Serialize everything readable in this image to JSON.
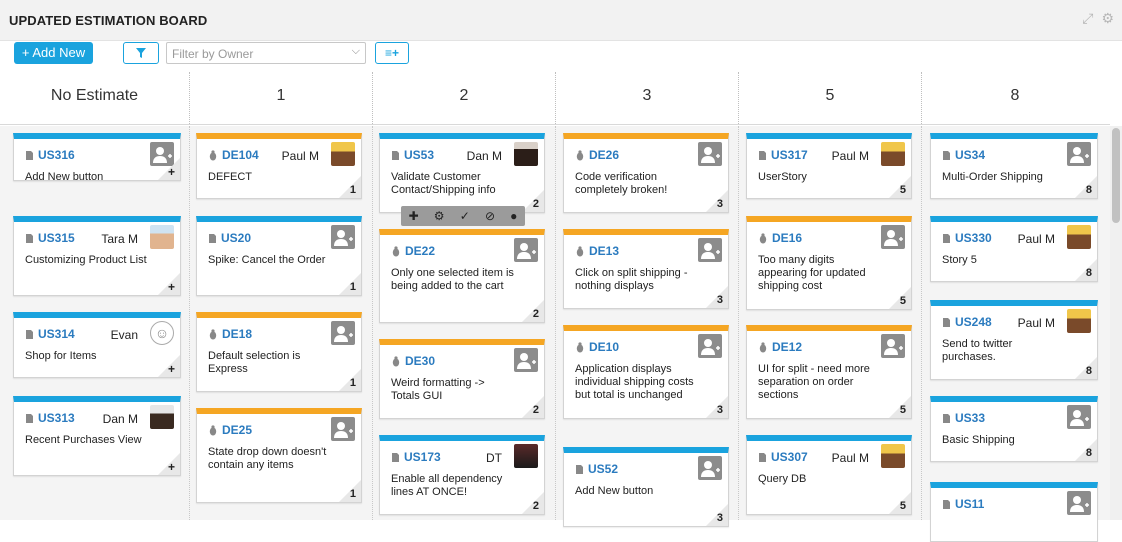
{
  "window": {
    "title": "UPDATED ESTIMATION BOARD"
  },
  "toolbar": {
    "add_label": "+ Add New",
    "owner_placeholder": "Filter by Owner",
    "rows_label": "≡+"
  },
  "columns": [
    {
      "label": "No Estimate"
    },
    {
      "label": "1"
    },
    {
      "label": "2"
    },
    {
      "label": "3"
    },
    {
      "label": "5"
    },
    {
      "label": "8"
    }
  ],
  "cards": {
    "c0": [
      {
        "id": "US316",
        "type": "story",
        "owner": "",
        "desc": "Add New button",
        "est": "+"
      },
      {
        "id": "US315",
        "type": "story",
        "owner": "Tara M",
        "desc": "Customizing Product List",
        "est": "+"
      },
      {
        "id": "US314",
        "type": "story",
        "owner": "Evan",
        "desc": "Shop for Items",
        "est": "+"
      },
      {
        "id": "US313",
        "type": "story",
        "owner": "Dan M",
        "desc": "Recent Purchases View",
        "est": "+"
      }
    ],
    "c1": [
      {
        "id": "DE104",
        "type": "defect",
        "owner": "Paul M",
        "desc": "DEFECT",
        "est": "1"
      },
      {
        "id": "US20",
        "type": "story",
        "owner": "",
        "desc": "Spike: Cancel the Order",
        "est": "1"
      },
      {
        "id": "DE18",
        "type": "defect",
        "owner": "",
        "desc": "Default selection is Express",
        "est": "1"
      },
      {
        "id": "DE25",
        "type": "defect",
        "owner": "",
        "desc": "State drop down doesn't contain any items",
        "est": "1"
      }
    ],
    "c2": [
      {
        "id": "US53",
        "type": "story",
        "owner": "Dan M",
        "desc": "Validate Customer Contact/Shipping info",
        "est": "2"
      },
      {
        "id": "DE22",
        "type": "defect",
        "owner": "",
        "desc": "Only one selected item is being added to the cart",
        "est": "2"
      },
      {
        "id": "DE30",
        "type": "defect",
        "owner": "",
        "desc": "Weird formatting -> Totals GUI",
        "est": "2"
      },
      {
        "id": "US173",
        "type": "story",
        "owner": "DT",
        "desc": "Enable all dependency lines AT ONCE!",
        "est": "2"
      }
    ],
    "c3": [
      {
        "id": "DE26",
        "type": "defect",
        "owner": "",
        "desc": "Code verification completely broken!",
        "est": "3"
      },
      {
        "id": "DE13",
        "type": "defect",
        "owner": "",
        "desc": "Click on split shipping - nothing displays",
        "est": "3"
      },
      {
        "id": "DE10",
        "type": "defect",
        "owner": "",
        "desc": "Application displays individual shipping costs but total is unchanged",
        "est": "3"
      },
      {
        "id": "US52",
        "type": "story",
        "owner": "",
        "desc": "Add New button",
        "est": "3"
      }
    ],
    "c4": [
      {
        "id": "US317",
        "type": "story",
        "owner": "Paul M",
        "desc": "UserStory",
        "est": "5"
      },
      {
        "id": "DE16",
        "type": "defect",
        "owner": "",
        "desc": "Too many digits appearing for updated shipping cost",
        "est": "5"
      },
      {
        "id": "DE12",
        "type": "defect",
        "owner": "",
        "desc": "UI for split - need more separation on order sections",
        "est": "5"
      },
      {
        "id": "US307",
        "type": "story",
        "owner": "Paul M",
        "desc": "Query DB",
        "est": "5"
      }
    ],
    "c5": [
      {
        "id": "US34",
        "type": "story",
        "owner": "",
        "desc": "Multi-Order Shipping",
        "est": "8"
      },
      {
        "id": "US330",
        "type": "story",
        "owner": "Paul M",
        "desc": "Story 5",
        "est": "8"
      },
      {
        "id": "US248",
        "type": "story",
        "owner": "Paul M",
        "desc": "Send to twitter purchases.",
        "est": "8"
      },
      {
        "id": "US33",
        "type": "story",
        "owner": "",
        "desc": "Basic Shipping",
        "est": "8"
      },
      {
        "id": "US11",
        "type": "story",
        "owner": "",
        "desc": "",
        "est": ""
      }
    ]
  },
  "colors": {
    "story": "#1aa3de",
    "defect": "#f5a623",
    "link": "#2b7bbf"
  }
}
